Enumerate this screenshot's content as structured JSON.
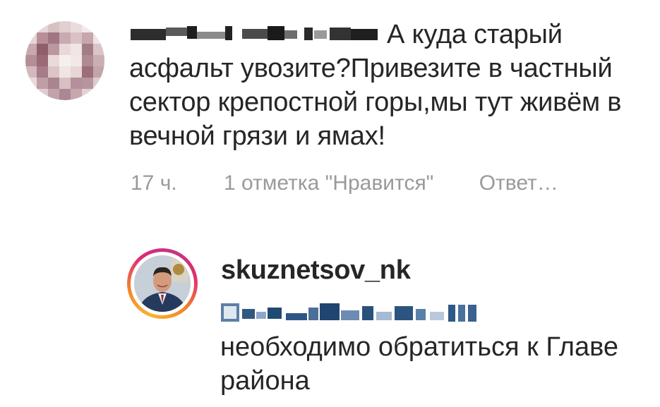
{
  "comment": {
    "username_blurred": "",
    "text": "А куда старый асфальт увозите?Привезите в частный сектор крепостной горы,мы тут живём в вечной грязи и ямах!",
    "time": "17 ч.",
    "likes": "1 отметка \"Нравится\"",
    "reply_label": "Ответ…"
  },
  "reply": {
    "username": "skuznetsov_nk",
    "mention_blurred": "",
    "text": "необходимо обратиться к Главе района"
  },
  "colors": {
    "text": "#262626",
    "meta": "#9a9a9a",
    "story_ring": [
      "#f9b52f",
      "#f58529",
      "#dd2a7b",
      "#c13584"
    ]
  },
  "icons": {
    "commenter_avatar": "pixelated-avatar-icon",
    "reply_avatar": "profile-photo-avatar"
  }
}
